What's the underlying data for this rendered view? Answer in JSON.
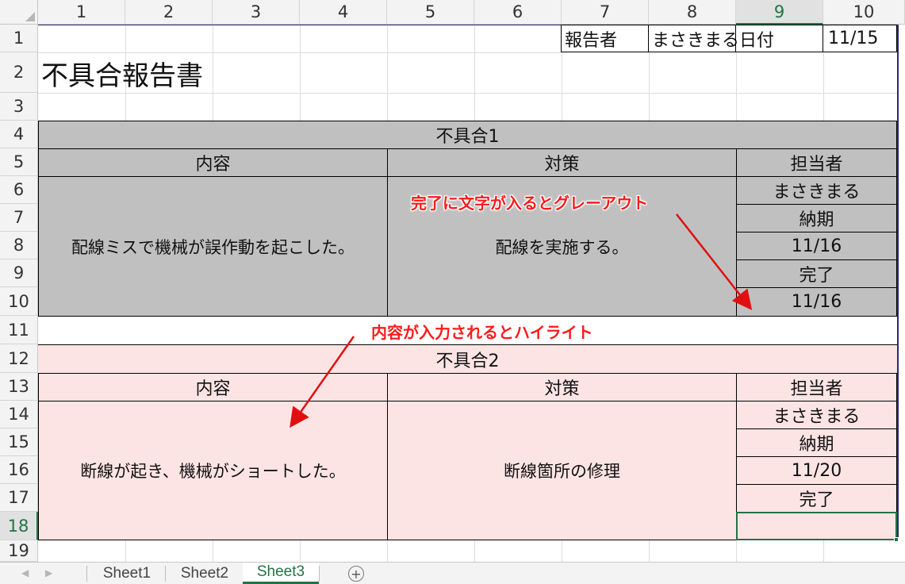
{
  "columns": [
    "1",
    "2",
    "3",
    "4",
    "5",
    "6",
    "7",
    "8",
    "9",
    "10"
  ],
  "rows": [
    "1",
    "2",
    "3",
    "4",
    "5",
    "6",
    "7",
    "8",
    "9",
    "10",
    "11",
    "12",
    "13",
    "14",
    "15",
    "16",
    "17",
    "18",
    "19"
  ],
  "header_info": {
    "reporter_label": "報告者",
    "reporter_name": "まさきまる",
    "date_label": "日付",
    "date_value": "11/15"
  },
  "title": "不具合報告書",
  "defect1": {
    "heading": "不具合1",
    "content_label": "内容",
    "measure_label": "対策",
    "owner_label": "担当者",
    "owner": "まさきまる",
    "due_label": "納期",
    "due": "11/16",
    "done_label": "完了",
    "done": "11/16",
    "content": "配線ミスで機械が誤作動を起こした。",
    "measure": "配線を実施する。"
  },
  "defect2": {
    "heading": "不具合2",
    "content_label": "内容",
    "measure_label": "対策",
    "owner_label": "担当者",
    "owner": "まさきまる",
    "due_label": "納期",
    "due": "11/20",
    "done_label": "完了",
    "done": "",
    "content": "断線が起き、機械がショートした。",
    "measure": "断線箇所の修理"
  },
  "annotations": {
    "gray_note": "完了に文字が入るとグレーアウト",
    "highlight_note": "内容が入力されるとハイライト"
  },
  "sheet_tabs": [
    "Sheet1",
    "Sheet2",
    "Sheet3"
  ],
  "active_sheet": "Sheet3",
  "colors": {
    "gray_fill": "#c0c0c0",
    "pink_fill": "#fde4e4",
    "annotation_red": "#ff1a1a",
    "excel_green": "#217346"
  }
}
